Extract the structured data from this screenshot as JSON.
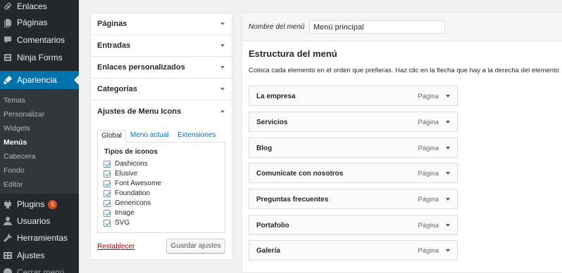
{
  "sidebar": {
    "items": [
      {
        "label": "Enlaces",
        "icon": "link-icon"
      },
      {
        "label": "Páginas",
        "icon": "pages-icon"
      },
      {
        "label": "Comentarios",
        "icon": "comments-icon"
      },
      {
        "label": "Ninja Forms",
        "icon": "forms-icon"
      },
      {
        "label": "Apariencia",
        "icon": "appearance-icon"
      },
      {
        "label": "Plugins",
        "icon": "plugins-icon",
        "badge": "5"
      },
      {
        "label": "Usuarios",
        "icon": "users-icon"
      },
      {
        "label": "Herramientas",
        "icon": "tools-icon"
      },
      {
        "label": "Ajustes",
        "icon": "settings-icon"
      },
      {
        "label": "Cerrar menú",
        "icon": "collapse-icon"
      }
    ],
    "submenu": [
      "Temas",
      "Personalizar",
      "Widgets",
      "Menús",
      "Cabecera",
      "Fondo",
      "Editor"
    ],
    "active_color": "#0073aa"
  },
  "left_panel": {
    "sections": [
      "Páginas",
      "Entradas",
      "Enlaces personalizados",
      "Categorías",
      "Ajustes de Menu Icons"
    ],
    "tabs": [
      "Global",
      "Menú actual",
      "Extensiones"
    ],
    "icon_types_title": "Tipos de iconos",
    "icon_types": [
      "Dashicons",
      "Elusive",
      "Font Awesome",
      "Foundation",
      "Genericons",
      "Image",
      "SVG"
    ],
    "reset_label": "Restablecer",
    "save_label": "Guardar ajustes"
  },
  "right_panel": {
    "menu_name_label": "Nombre del menú",
    "menu_name_value": "Menú principal",
    "structure_title": "Estructura del menú",
    "structure_desc": "Coloca cada elemento en el orden que prefieras. Haz clic en la flecha que hay a la derecha del elemento",
    "items": [
      {
        "title": "La empresa",
        "type": "Página"
      },
      {
        "title": "Servicios",
        "type": "Página"
      },
      {
        "title": "Blog",
        "type": "Página"
      },
      {
        "title": "Comunícate con nosotros",
        "type": "Página"
      },
      {
        "title": "Preguntas frecuentes",
        "type": "Página"
      },
      {
        "title": "Portafolio",
        "type": "Página"
      },
      {
        "title": "Galería",
        "type": "Página"
      }
    ]
  }
}
